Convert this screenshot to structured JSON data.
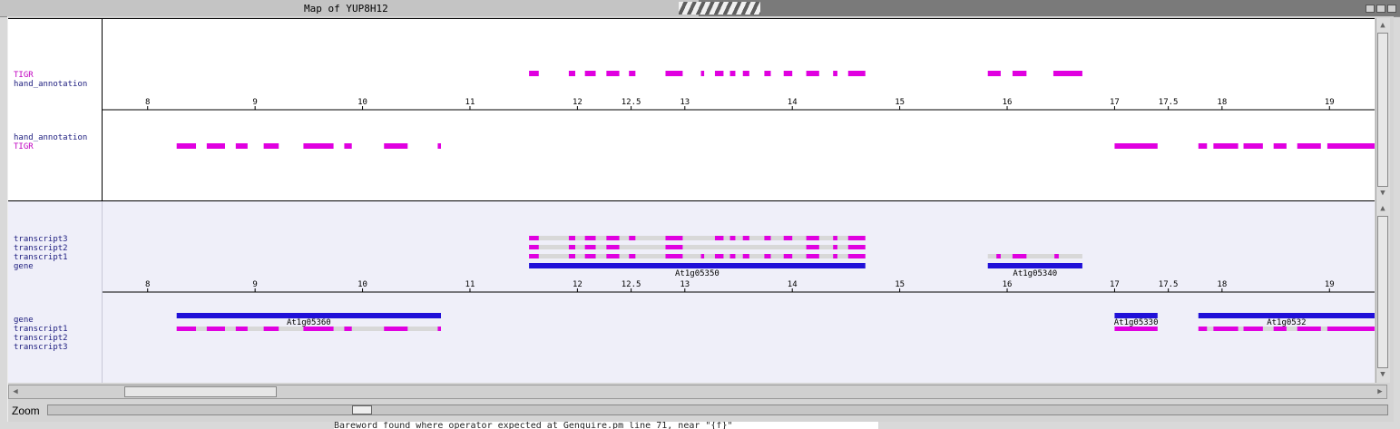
{
  "window": {
    "title": "Map of YUP8H12"
  },
  "top_panel": {
    "upper_labels": [
      {
        "text": "TIGR",
        "color": "#c000c0"
      },
      {
        "text": "hand_annotation",
        "color": "#202080"
      }
    ],
    "lower_labels": [
      {
        "text": "hand_annotation",
        "color": "#202080"
      },
      {
        "text": "TIGR",
        "color": "#c000c0"
      }
    ]
  },
  "bottom_panel": {
    "upper_labels": [
      {
        "text": "transcript3",
        "color": "#202080"
      },
      {
        "text": "transcript2",
        "color": "#202080"
      },
      {
        "text": "transcript1",
        "color": "#202080"
      },
      {
        "text": "gene",
        "color": "#202080"
      }
    ],
    "lower_labels": [
      {
        "text": "gene",
        "color": "#202080"
      },
      {
        "text": "transcript1",
        "color": "#202080"
      },
      {
        "text": "transcript2",
        "color": "#202080"
      },
      {
        "text": "transcript3",
        "color": "#202080"
      }
    ]
  },
  "ruler_ticks": [
    "8",
    "9",
    "10",
    "11",
    "12",
    "12.5",
    "13",
    "14",
    "15",
    "16",
    "17",
    "17.5",
    "18",
    "19"
  ],
  "tick_values": [
    8,
    9,
    10,
    11,
    12,
    12.5,
    13,
    14,
    15,
    16,
    17,
    17.5,
    18,
    19
  ],
  "map_range": [
    7.58,
    19.42
  ],
  "tigr_upper_features": [
    [
      11.55,
      11.64
    ],
    [
      11.92,
      11.98
    ],
    [
      12.07,
      12.17
    ],
    [
      12.27,
      12.39
    ],
    [
      12.48,
      12.54
    ],
    [
      12.82,
      12.98
    ],
    [
      13.15,
      13.18
    ],
    [
      13.28,
      13.36
    ],
    [
      13.42,
      13.47
    ],
    [
      13.54,
      13.6
    ],
    [
      13.74,
      13.8
    ],
    [
      13.92,
      14.0
    ],
    [
      14.13,
      14.25
    ],
    [
      14.38,
      14.42
    ],
    [
      14.52,
      14.68
    ],
    [
      15.82,
      15.94
    ],
    [
      16.05,
      16.18
    ],
    [
      16.43,
      16.7
    ]
  ],
  "tigr_lower_features": [
    [
      8.27,
      8.45
    ],
    [
      8.55,
      8.72
    ],
    [
      8.82,
      8.93
    ],
    [
      9.08,
      9.22
    ],
    [
      9.45,
      9.73
    ],
    [
      9.83,
      9.9
    ],
    [
      10.2,
      10.42
    ],
    [
      10.7,
      10.73
    ],
    [
      17.0,
      17.4
    ],
    [
      17.78,
      17.86
    ],
    [
      17.92,
      18.15
    ],
    [
      18.2,
      18.38
    ],
    [
      18.48,
      18.6
    ],
    [
      18.7,
      18.92
    ],
    [
      18.98,
      19.42
    ]
  ],
  "genes_upper": [
    {
      "name": "At1g05350",
      "span": [
        11.55,
        14.68
      ],
      "t1": [
        [
          11.55,
          11.64
        ],
        [
          11.92,
          11.98
        ],
        [
          12.07,
          12.17
        ],
        [
          12.27,
          12.39
        ],
        [
          12.48,
          12.54
        ],
        [
          12.82,
          12.98
        ],
        [
          13.15,
          13.18
        ],
        [
          13.28,
          13.36
        ],
        [
          13.42,
          13.47
        ],
        [
          13.54,
          13.6
        ],
        [
          13.74,
          13.8
        ],
        [
          13.92,
          14.0
        ],
        [
          14.13,
          14.25
        ],
        [
          14.38,
          14.42
        ],
        [
          14.52,
          14.68
        ]
      ],
      "t2": [
        [
          11.55,
          11.64
        ],
        [
          11.92,
          11.98
        ],
        [
          12.07,
          12.17
        ],
        [
          12.27,
          12.39
        ],
        [
          12.82,
          12.98
        ],
        [
          14.13,
          14.25
        ],
        [
          14.38,
          14.42
        ],
        [
          14.52,
          14.68
        ]
      ],
      "t3": [
        [
          11.55,
          11.64
        ],
        [
          11.92,
          11.98
        ],
        [
          12.07,
          12.17
        ],
        [
          12.27,
          12.39
        ],
        [
          12.48,
          12.54
        ],
        [
          12.82,
          12.98
        ],
        [
          13.28,
          13.36
        ],
        [
          13.42,
          13.47
        ],
        [
          13.54,
          13.6
        ],
        [
          13.74,
          13.8
        ],
        [
          13.92,
          14.0
        ],
        [
          14.13,
          14.25
        ],
        [
          14.38,
          14.42
        ],
        [
          14.52,
          14.68
        ]
      ]
    },
    {
      "name": "At1g05340",
      "span": [
        15.82,
        16.7
      ],
      "t1": [
        [
          15.9,
          15.94
        ],
        [
          16.05,
          16.18
        ],
        [
          16.44,
          16.48
        ]
      ]
    }
  ],
  "genes_lower": [
    {
      "name": "At1g05360",
      "span": [
        8.27,
        10.73
      ],
      "t1": [
        [
          8.27,
          8.45
        ],
        [
          8.55,
          8.72
        ],
        [
          8.82,
          8.93
        ],
        [
          9.08,
          9.22
        ],
        [
          9.45,
          9.73
        ],
        [
          9.83,
          9.9
        ],
        [
          10.2,
          10.42
        ],
        [
          10.7,
          10.73
        ]
      ]
    },
    {
      "name": "At1g05330",
      "span": [
        17.0,
        17.4
      ],
      "t1": [
        [
          17.0,
          17.4
        ]
      ]
    },
    {
      "name": "At1g0532",
      "span": [
        17.78,
        19.42
      ],
      "t1": [
        [
          17.78,
          17.86
        ],
        [
          17.92,
          18.15
        ],
        [
          18.2,
          18.38
        ],
        [
          18.48,
          18.6
        ],
        [
          18.7,
          18.92
        ],
        [
          18.98,
          19.42
        ]
      ]
    }
  ],
  "colors": {
    "feature": "#e000e0",
    "gene": "#2010d8",
    "intron": "#d8d8d8",
    "tick_text": "#000000"
  },
  "zoom": {
    "label": "Zoom"
  },
  "console": {
    "text": "Bareword found where operator expected at Genquire.pm line 71, near \"{f}\""
  }
}
